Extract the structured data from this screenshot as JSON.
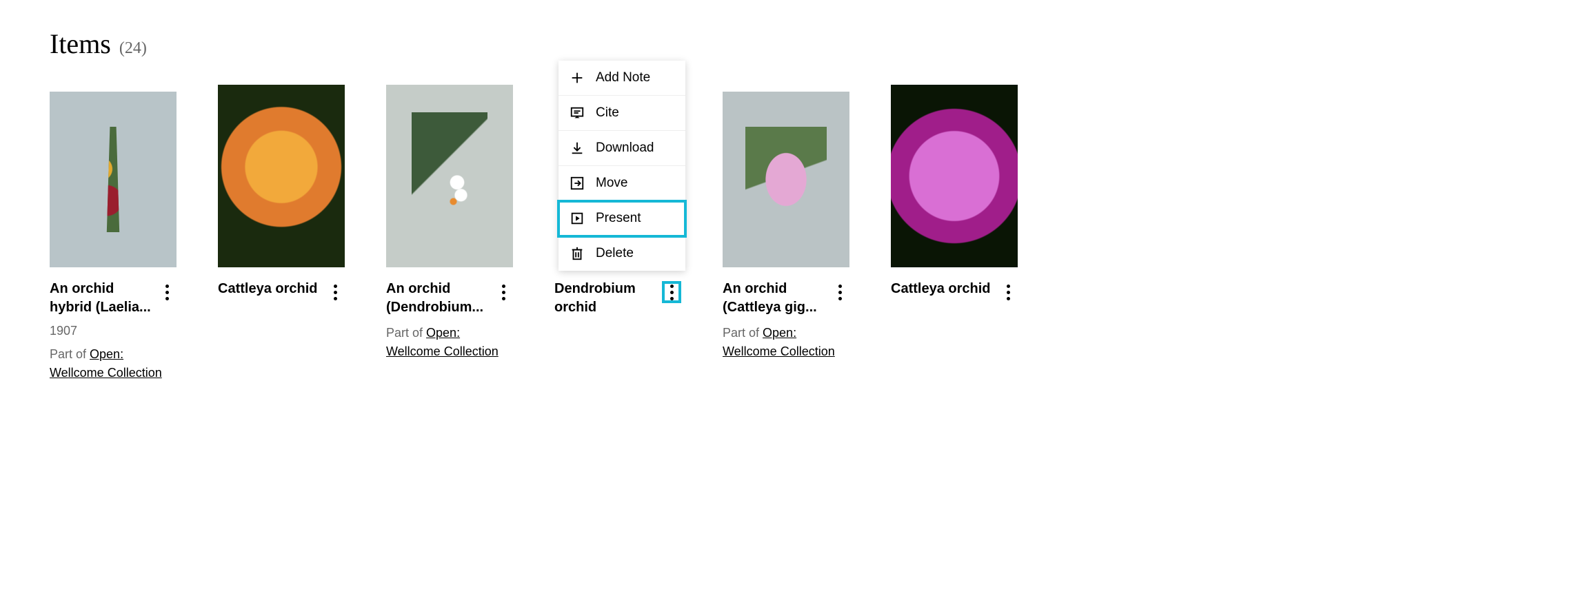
{
  "section": {
    "title": "Items",
    "count": "(24)"
  },
  "partof_prefix": "Part of ",
  "items": [
    {
      "title": "An orchid hybrid (Laelia...",
      "date": "1907",
      "partof": "Open: Wellcome Collection"
    },
    {
      "title": "Cattleya orchid"
    },
    {
      "title": "An orchid (Dendrobium...",
      "partof": "Open: Wellcome Collection"
    },
    {
      "title": "Dendrobium orchid"
    },
    {
      "title": "An orchid (Cattleya gig...",
      "partof": "Open: Wellcome Collection"
    },
    {
      "title": "Cattleya orchid"
    }
  ],
  "menu": {
    "add_note": "Add Note",
    "cite": "Cite",
    "download": "Download",
    "move": "Move",
    "present": "Present",
    "delete": "Delete"
  }
}
